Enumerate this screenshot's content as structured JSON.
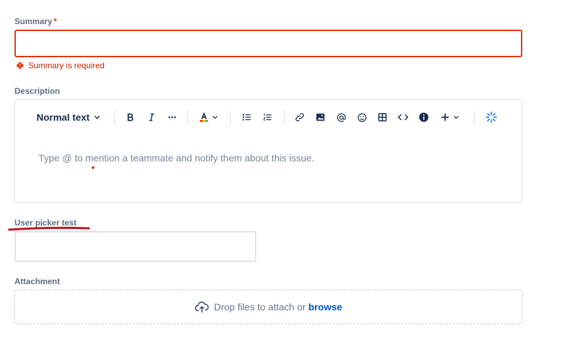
{
  "summary": {
    "label": "Summary",
    "required_mark": "*",
    "value": "",
    "error": "Summary is required"
  },
  "description": {
    "label": "Description",
    "toolbar": {
      "text_style": "Normal text",
      "items": [
        "text-style-dropdown",
        "bold",
        "italic",
        "more-formatting",
        "text-color",
        "bullet-list",
        "numbered-list",
        "link",
        "image",
        "mention",
        "emoji",
        "table",
        "code",
        "info-panel",
        "insert-more",
        "ai-assist"
      ]
    },
    "placeholder": "Type @ to mention a teammate and notify them about this issue."
  },
  "user_picker": {
    "label": "User picker test",
    "value": ""
  },
  "attachment": {
    "label": "Attachment",
    "drop_text": "Drop files to attach or",
    "browse": "browse"
  },
  "colors": {
    "error": "#de350b",
    "link": "#0052cc",
    "border": "#dfe1e6",
    "label": "#5e6c84"
  }
}
